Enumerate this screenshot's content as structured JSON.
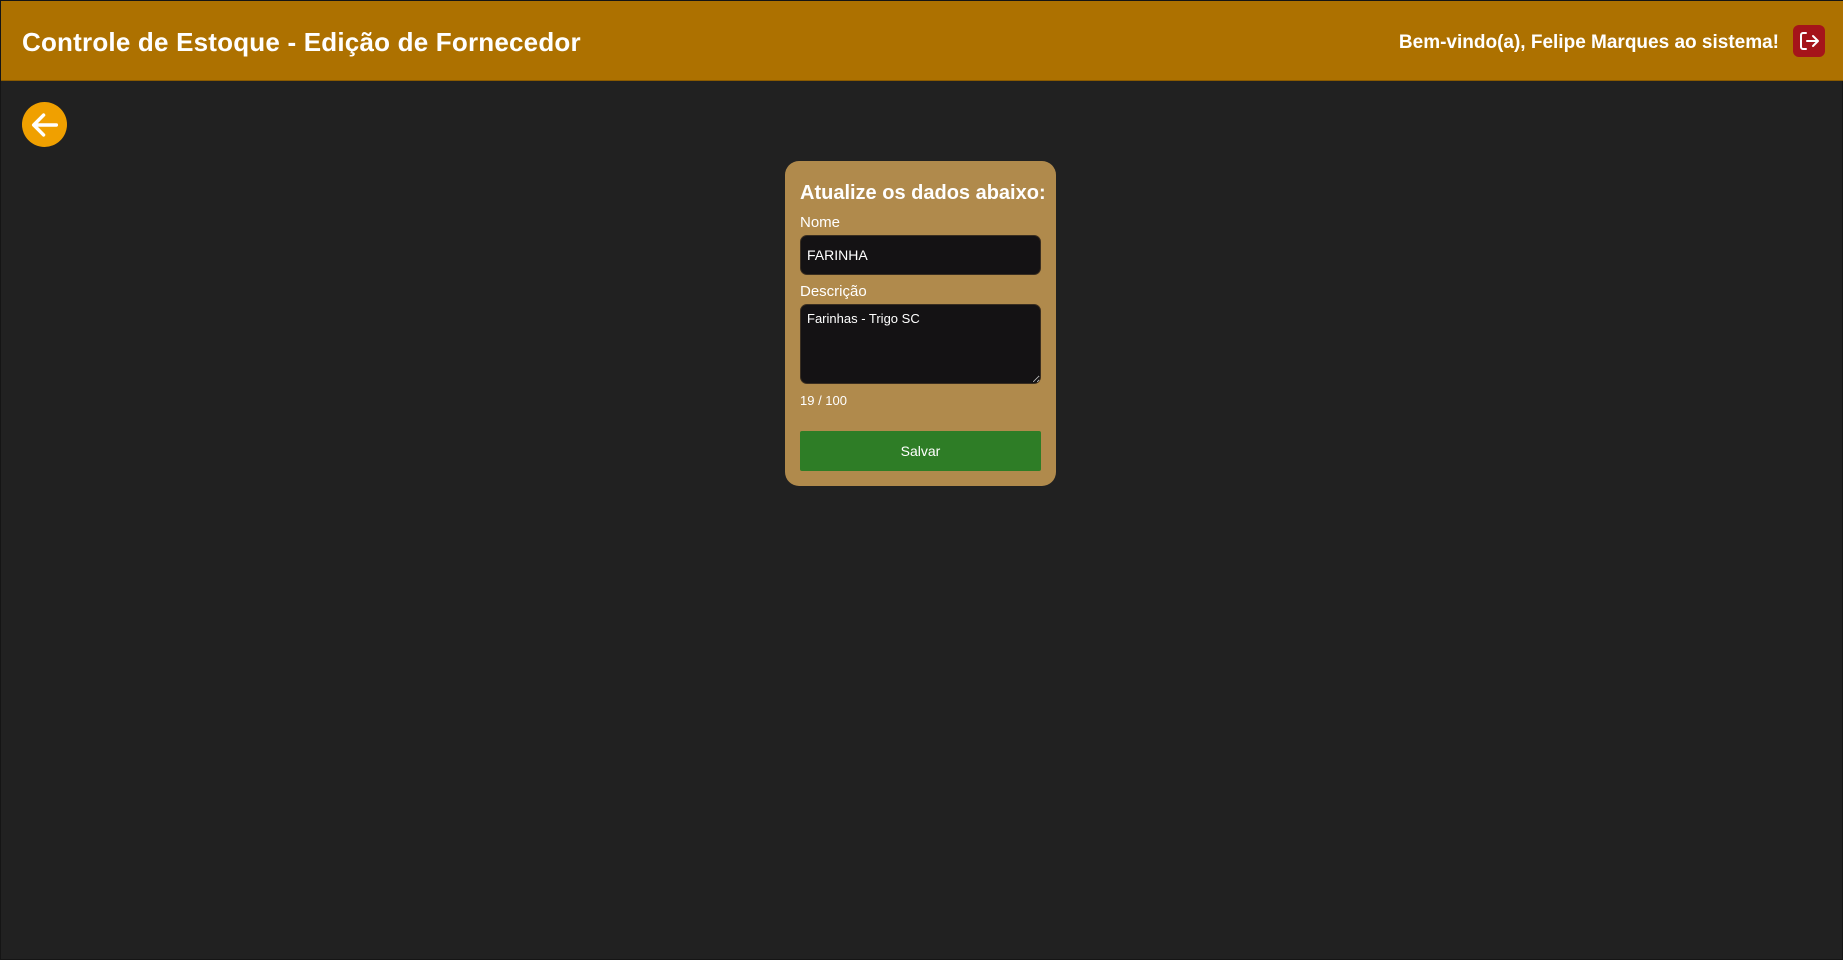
{
  "header": {
    "title": "Controle de Estoque - Edição de Fornecedor",
    "welcome": "Bem-vindo(a), Felipe Marques ao sistema!",
    "logout_icon": "logout-icon"
  },
  "navigation": {
    "back_icon": "arrow-left-icon"
  },
  "form": {
    "title": "Atualize os dados abaixo:",
    "name_label": "Nome",
    "name_value": "FARINHA",
    "description_label": "Descrição",
    "description_value": "Farinhas - Trigo SC",
    "char_count": "19 / 100",
    "save_label": "Salvar"
  },
  "colors": {
    "header_bg": "#ad7100",
    "page_bg": "#212121",
    "card_bg": "#b08a4c",
    "save_button": "#2e7d26",
    "back_button": "#f0a000",
    "logout_button": "#a5141a"
  }
}
